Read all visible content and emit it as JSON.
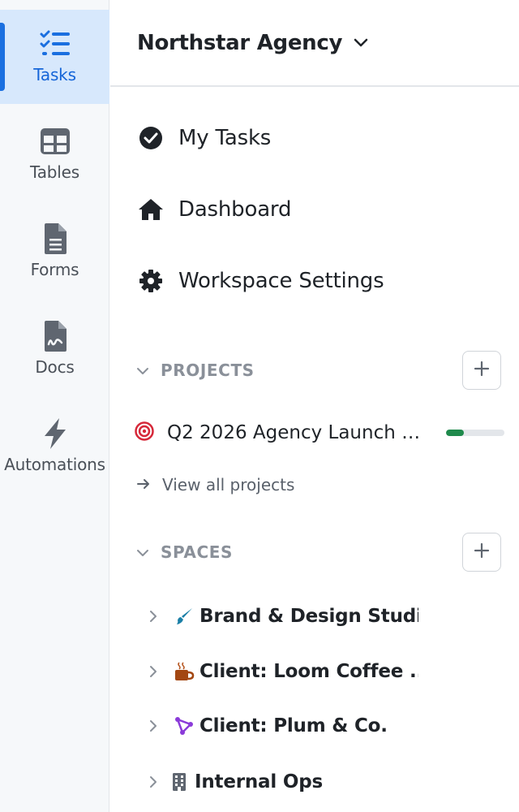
{
  "rail": {
    "items": [
      {
        "label": "Tasks",
        "icon": "tasks-icon",
        "active": true
      },
      {
        "label": "Tables",
        "icon": "table-icon",
        "active": false
      },
      {
        "label": "Forms",
        "icon": "form-icon",
        "active": false
      },
      {
        "label": "Docs",
        "icon": "doc-icon",
        "active": false
      },
      {
        "label": "Automations",
        "icon": "lightning-icon",
        "active": false
      }
    ]
  },
  "header": {
    "workspace_name": "Northstar Agency"
  },
  "nav": {
    "items": [
      {
        "label": "My Tasks",
        "icon": "check-circle-icon"
      },
      {
        "label": "Dashboard",
        "icon": "home-icon"
      },
      {
        "label": "Workspace Settings",
        "icon": "gear-icon"
      }
    ]
  },
  "projects": {
    "heading": "PROJECTS",
    "items": [
      {
        "name": "Q2 2026 Agency Launch P...",
        "icon": "target-icon",
        "progress_percent": 30
      }
    ],
    "view_all_label": "View all projects"
  },
  "spaces": {
    "heading": "SPACES",
    "items": [
      {
        "name": "Brand & Design Studio",
        "icon": "paintbrush-icon"
      },
      {
        "name": "Client: Loom Coffee ...",
        "icon": "coffee-icon"
      },
      {
        "name": "Client: Plum & Co.",
        "icon": "network-icon"
      },
      {
        "name": "Internal Ops",
        "icon": "building-icon"
      }
    ]
  },
  "colors": {
    "accent": "#1a6fe0",
    "active_bg": "#d7e8fc",
    "progress_fill": "#1f8a4c",
    "target": "#d62839"
  }
}
